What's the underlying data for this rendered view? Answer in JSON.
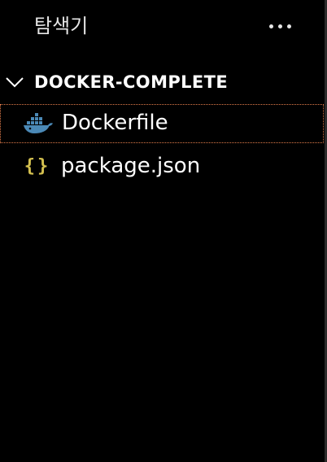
{
  "header": {
    "title": "탐색기",
    "more_icon": "more-horizontal-icon"
  },
  "section": {
    "title": "DOCKER-COMPLETE",
    "expanded": true,
    "chevron_icon": "chevron-down-icon"
  },
  "files": [
    {
      "label": "Dockerfile",
      "icon": "docker-whale-icon",
      "icon_color": "#4b89b6",
      "selected": true
    },
    {
      "label": "package.json",
      "icon": "json-braces-icon",
      "icon_glyph": "{}",
      "icon_color": "#d4c04f",
      "selected": false
    }
  ],
  "colors": {
    "background": "#000000",
    "text": "#ffffff",
    "selection_outline": "#e07b4a"
  }
}
